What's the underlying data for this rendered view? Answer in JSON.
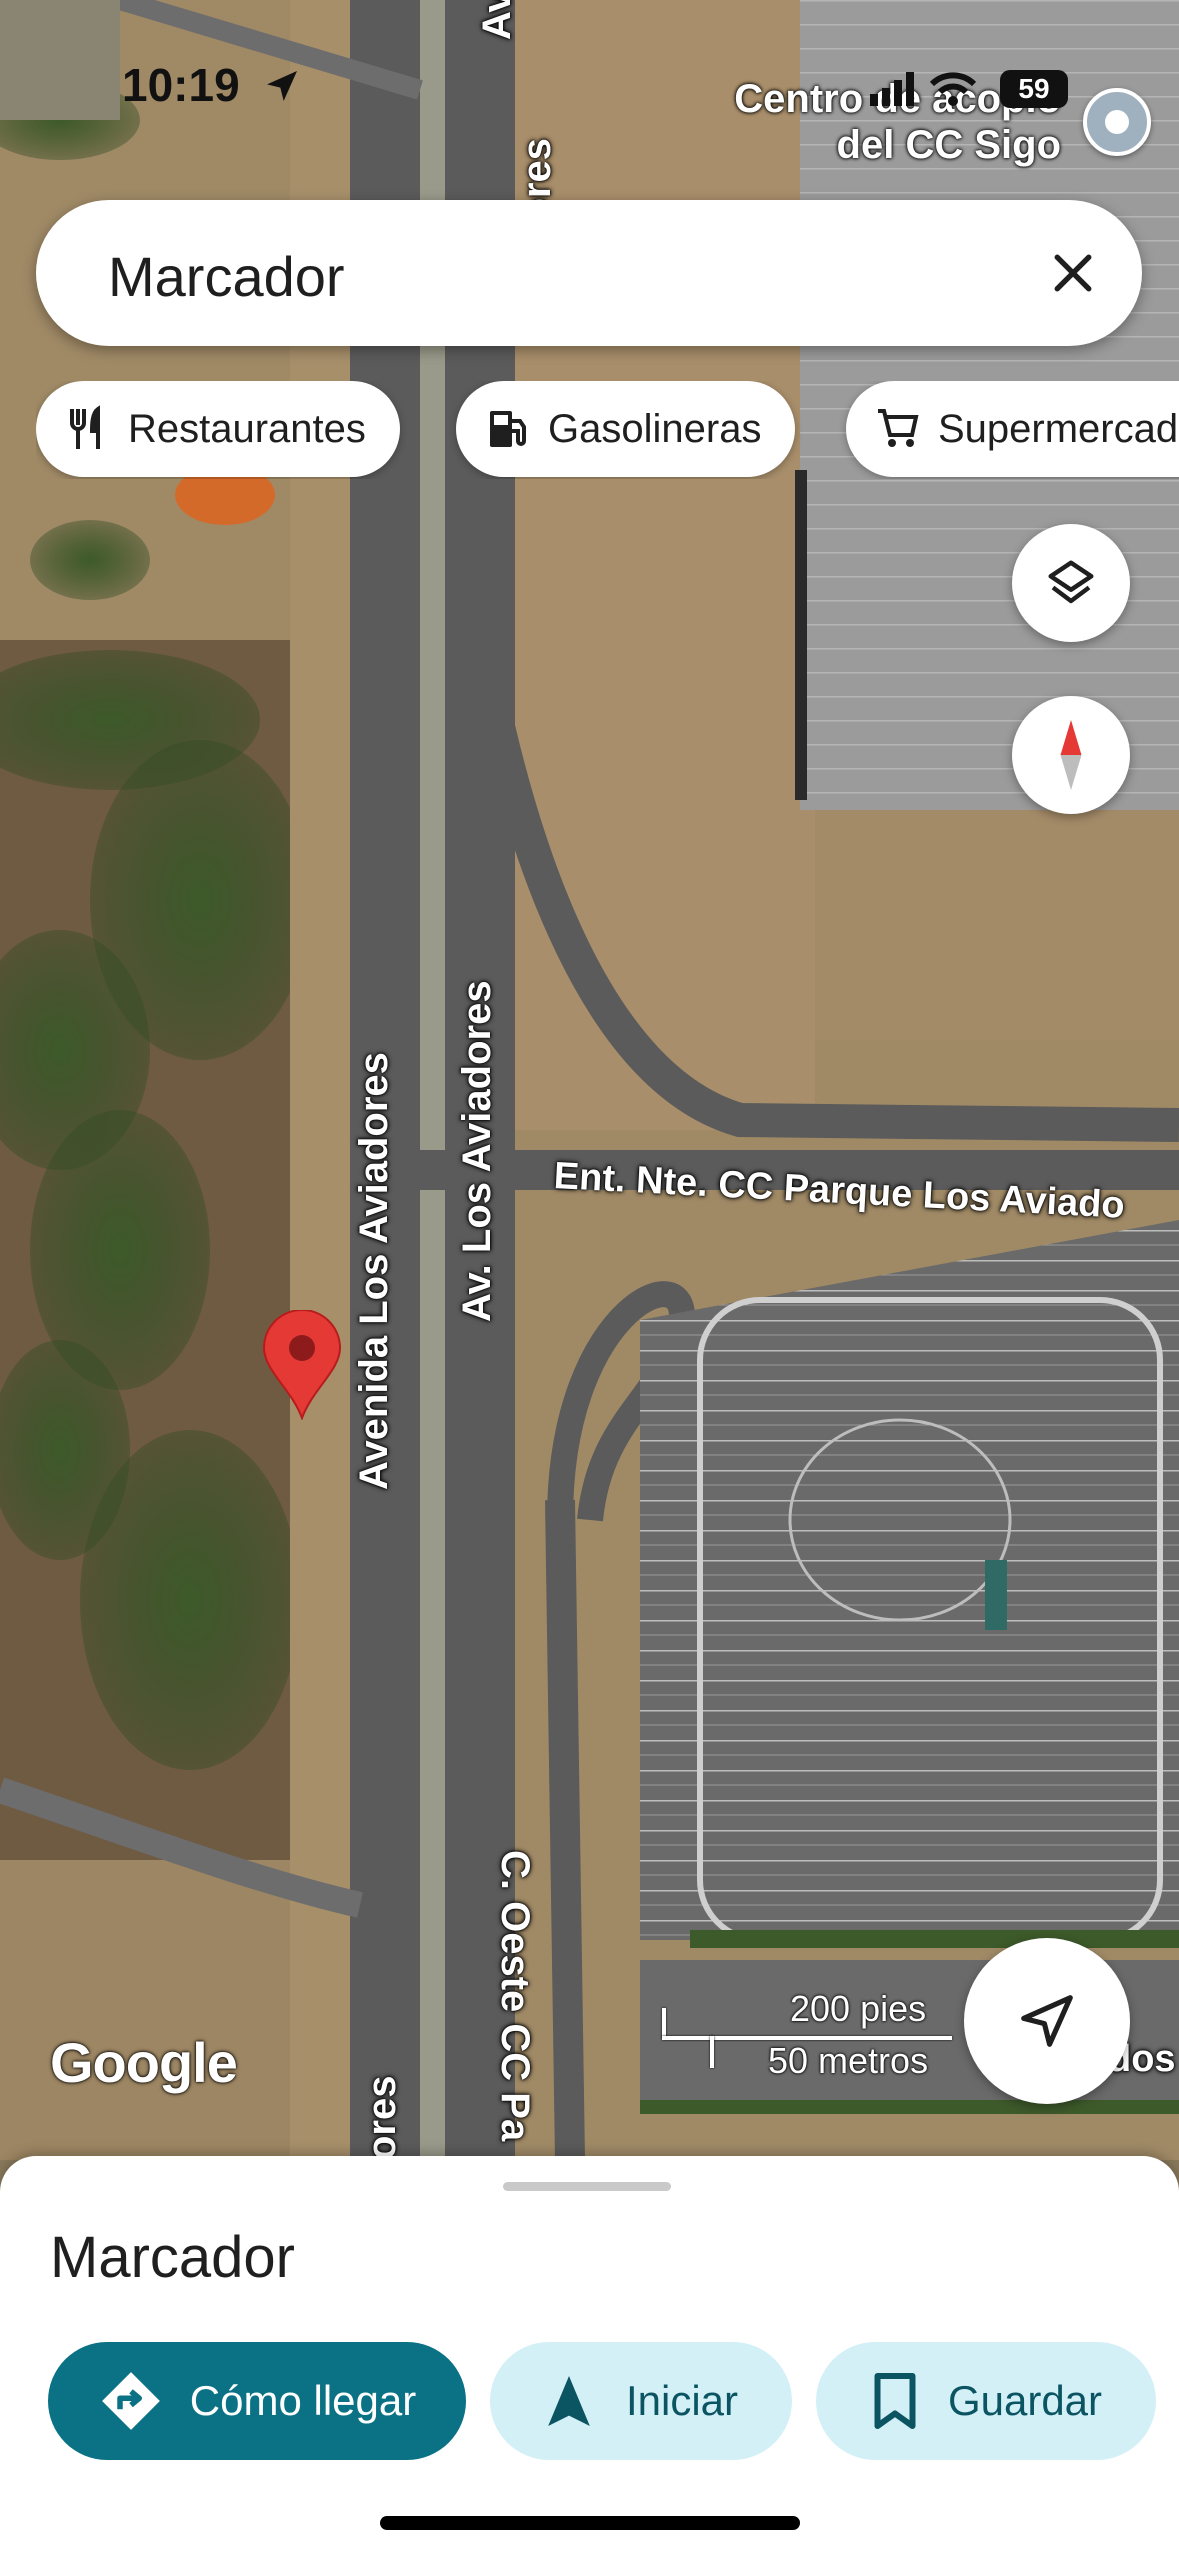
{
  "status_bar": {
    "time": "10:19",
    "battery": "59"
  },
  "map": {
    "poi_label": [
      "Centro de acopio",
      "del CC Sigo"
    ],
    "road_labels": {
      "avenida_los_aviadores": "Avenida Los Aviadores",
      "av_los_aviadores": "Av. Los Aviadores",
      "ent_nte": "Ent. Nte. CC Parque Los Aviado",
      "c_oeste": "C. Oeste CC Pa",
      "top_aviadores": "Aviadores",
      "bottom_ores": "ores",
      "top_a": "Av",
      "right_dos": "dos"
    },
    "attribution": "Google",
    "scale": {
      "imperial": "200 pies",
      "metric": "50 metros"
    }
  },
  "search": {
    "value": "Marcador",
    "clear_icon": "close-icon"
  },
  "chips": [
    {
      "label": "Restaurantes",
      "icon": "fork-knife-icon"
    },
    {
      "label": "Gasolineras",
      "icon": "gas-station-icon"
    },
    {
      "label": "Supermercados",
      "icon": "cart-icon"
    }
  ],
  "controls": {
    "layers_icon": "layers-icon",
    "compass_icon": "compass-icon",
    "location_icon": "navigation-arrow-icon"
  },
  "sheet": {
    "title": "Marcador",
    "actions": {
      "directions": "Cómo llegar",
      "start": "Iniciar",
      "save": "Guardar"
    }
  },
  "colors": {
    "accent": "#0b7285",
    "tonal": "#d3f0f7",
    "pin": "#e53935"
  }
}
